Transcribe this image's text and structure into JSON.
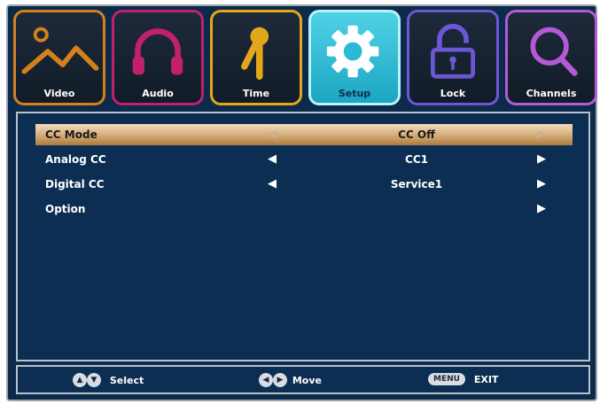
{
  "tabs": [
    {
      "label": "Video",
      "icon": "mountain-image-icon",
      "color": "#d6801c"
    },
    {
      "label": "Audio",
      "icon": "headphones-icon",
      "color": "#c1206e"
    },
    {
      "label": "Time",
      "icon": "pin-icon",
      "color": "#e3a71c"
    },
    {
      "label": "Setup",
      "icon": "gear-icon",
      "color": "#1fb5d1",
      "active": true
    },
    {
      "label": "Lock",
      "icon": "padlock-icon",
      "color": "#6c57d4"
    },
    {
      "label": "Channels",
      "icon": "magnifier-icon",
      "color": "#b45ad6"
    }
  ],
  "menu": {
    "rows": [
      {
        "name": "CC Mode",
        "value": "CC Off",
        "left_arrow": true,
        "right_arrow": true,
        "selected": true
      },
      {
        "name": "Analog CC",
        "value": "CC1",
        "left_arrow": true,
        "right_arrow": true
      },
      {
        "name": "Digital CC",
        "value": "Service1",
        "left_arrow": true,
        "right_arrow": true
      },
      {
        "name": "Option",
        "value": "",
        "left_arrow": false,
        "right_arrow": true
      }
    ]
  },
  "footer": {
    "select_label": "Select",
    "move_label": "Move",
    "menu_button_label": "MENU",
    "exit_label": "EXIT"
  },
  "colors": {
    "background": "#0c2a4a",
    "highlight": "#c99b60",
    "active_tab": "#1fb5d1"
  }
}
